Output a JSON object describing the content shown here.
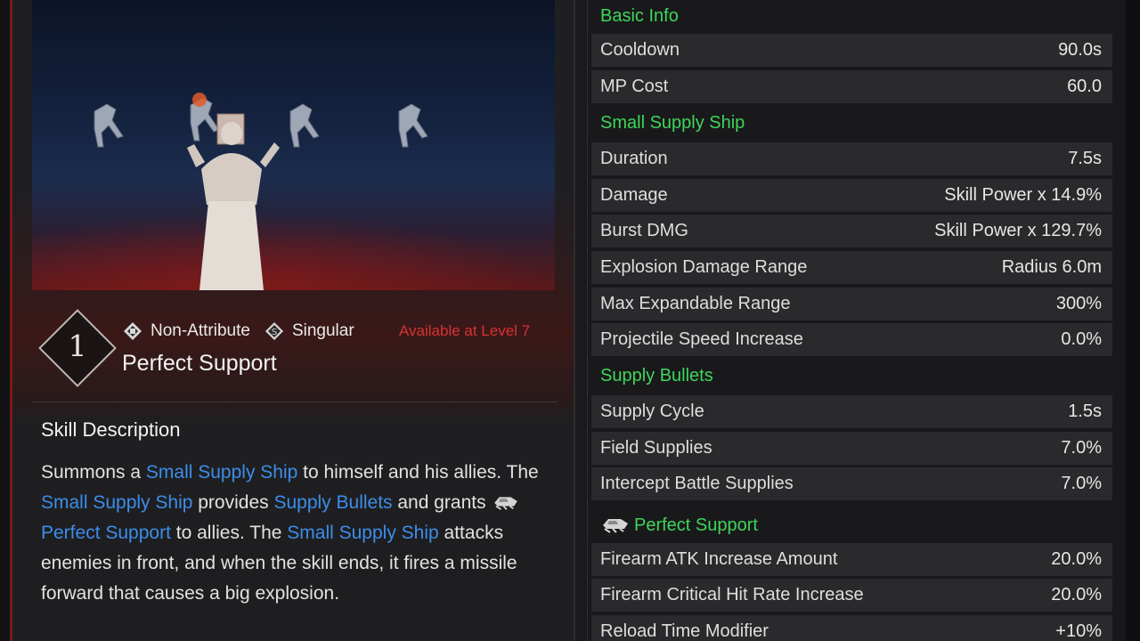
{
  "skill": {
    "level_number": "1",
    "attribute": "Non-Attribute",
    "type": "Singular",
    "availability": "Available at Level 7",
    "name": "Perfect Support"
  },
  "description": {
    "title": "Skill Description",
    "segments": [
      {
        "t": "Summons a ",
        "hl": false
      },
      {
        "t": "Small Supply Ship",
        "hl": true
      },
      {
        "t": " to himself and his allies. The ",
        "hl": false
      },
      {
        "t": "Small Supply Ship",
        "hl": true
      },
      {
        "t": " provides ",
        "hl": false
      },
      {
        "t": "Supply Bullets",
        "hl": true
      },
      {
        "t": " and grants ",
        "hl": false
      },
      {
        "icon": "supply-ship-icon"
      },
      {
        "t": "Perfect Support",
        "hl": true
      },
      {
        "t": " to allies. The ",
        "hl": false
      },
      {
        "t": "Small Supply Ship",
        "hl": true
      },
      {
        "t": " attacks enemies in front, and when the skill ends, it fires a missile forward that causes a big explosion.",
        "hl": false
      }
    ]
  },
  "stats": [
    {
      "kind": "section",
      "label": "Basic Info"
    },
    {
      "kind": "stat",
      "label": "Cooldown",
      "value": "90.0s"
    },
    {
      "kind": "stat",
      "label": "MP Cost",
      "value": "60.0"
    },
    {
      "kind": "section",
      "label": "Small Supply Ship"
    },
    {
      "kind": "stat",
      "label": "Duration",
      "value": "7.5s"
    },
    {
      "kind": "stat",
      "label": "Damage",
      "value": "Skill Power x 14.9%"
    },
    {
      "kind": "stat",
      "label": "Burst DMG",
      "value": "Skill Power x 129.7%"
    },
    {
      "kind": "stat",
      "label": "Explosion Damage Range",
      "value": "Radius 6.0m"
    },
    {
      "kind": "stat",
      "label": "Max Expandable Range",
      "value": "300%"
    },
    {
      "kind": "stat",
      "label": "Projectile Speed Increase",
      "value": "0.0%"
    },
    {
      "kind": "section",
      "label": "Supply Bullets"
    },
    {
      "kind": "stat",
      "label": "Supply Cycle",
      "value": "1.5s"
    },
    {
      "kind": "stat",
      "label": "Field Supplies",
      "value": "7.0%"
    },
    {
      "kind": "stat",
      "label": "Intercept Battle Supplies",
      "value": "7.0%"
    },
    {
      "kind": "section",
      "label": "Perfect Support",
      "icon": "supply-ship-icon"
    },
    {
      "kind": "stat",
      "label": "Firearm ATK Increase Amount",
      "value": "20.0%"
    },
    {
      "kind": "stat",
      "label": "Firearm Critical Hit Rate Increase",
      "value": "20.0%"
    },
    {
      "kind": "stat",
      "label": "Reload Time Modifier",
      "value": "+10%"
    }
  ],
  "colors": {
    "section_green": "#3ed55a",
    "highlight_blue": "#3c8dea",
    "availability_red": "#d93232",
    "stat_row_bg": "#2a2a2d"
  }
}
